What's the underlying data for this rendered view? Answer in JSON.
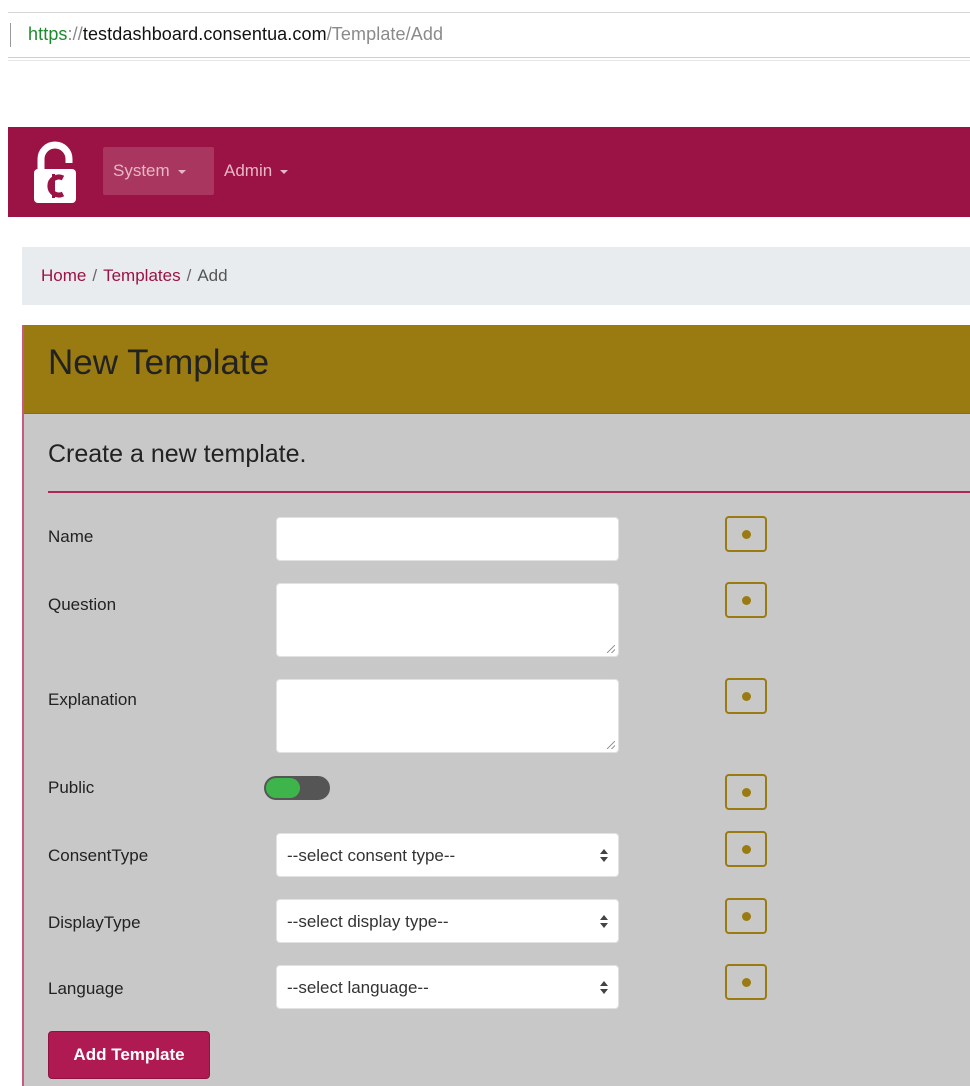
{
  "browser": {
    "url_scheme": "https",
    "url_separator": "://",
    "url_host": "testdashboard.consentua.com",
    "url_path": "/Template/Add"
  },
  "navbar": {
    "logo_icon": "consentua-padlock-c-logo",
    "menus": [
      {
        "label": "System"
      },
      {
        "label": "Admin"
      }
    ],
    "color": "#9b1244"
  },
  "breadcrumb": {
    "items": [
      {
        "label": "Home"
      },
      {
        "label": "Templates"
      },
      {
        "label": "Add"
      }
    ],
    "separator": "/"
  },
  "card": {
    "title": "New Template",
    "subtitle": "Create a new template.",
    "header_color": "#9a7b11",
    "fields": {
      "name": {
        "label": "Name",
        "value": ""
      },
      "question": {
        "label": "Question",
        "value": ""
      },
      "explanation": {
        "label": "Explanation",
        "value": ""
      },
      "public": {
        "label": "Public",
        "checked": true
      },
      "consent_type": {
        "label": "ConsentType",
        "selected": "--select consent type--"
      },
      "display_type": {
        "label": "DisplayType",
        "selected": "--select display type--"
      },
      "language": {
        "label": "Language",
        "selected": "--select language--"
      }
    },
    "info_icon": "info-dot-icon",
    "submit_label": "Add Template",
    "submit_color": "#b01a52"
  }
}
